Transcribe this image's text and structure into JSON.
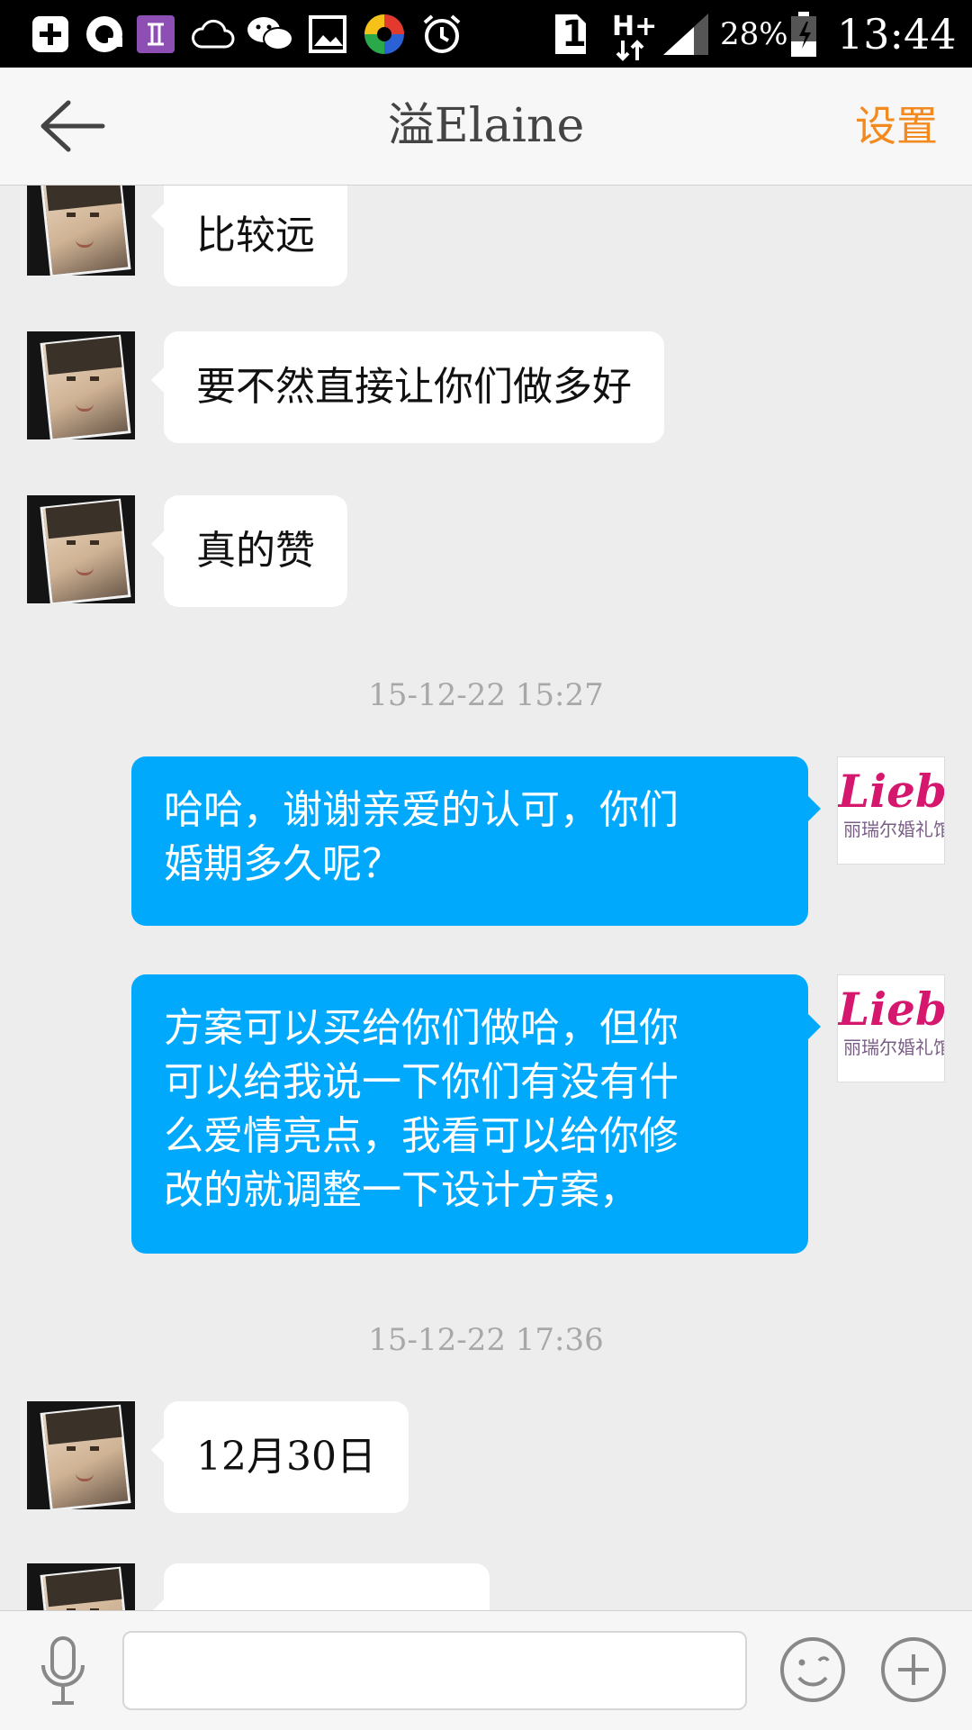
{
  "status_bar": {
    "battery": "28%",
    "time": "13:44",
    "sim": "1",
    "network": "H+",
    "icons": [
      "add-box-icon",
      "qq-icon",
      "gemini-icon",
      "cloud-icon",
      "wechat-icon",
      "gallery-icon",
      "pinwheel-icon",
      "alarm-icon",
      "sim-icon",
      "network-icon",
      "signal-icon",
      "battery-icon"
    ]
  },
  "header": {
    "title": "溢Elaine",
    "settings_label": "设置"
  },
  "messages": [
    {
      "side": "in",
      "text": "比较远"
    },
    {
      "side": "in",
      "text": "要不然直接让你们做多好"
    },
    {
      "side": "in",
      "text": "真的赞"
    },
    {
      "type": "time",
      "text": "15-12-22 15:27"
    },
    {
      "side": "out",
      "lines": [
        "哈哈，谢谢亲爱的认可，你们",
        "婚期多久呢？"
      ]
    },
    {
      "side": "out",
      "lines": [
        "方案可以买给你们做哈，但你",
        "可以给我说一下你们有没有什",
        "么爱情亮点，我看可以给你修",
        "改的就调整一下设计方案，"
      ]
    },
    {
      "type": "time",
      "text": "15-12-22 17:36"
    },
    {
      "side": "in",
      "text": "12月30日"
    },
    {
      "side": "in",
      "text": "…"
    }
  ],
  "self_avatar": {
    "brand": "Liebe",
    "sub": "丽瑞尔婚礼馆"
  },
  "input": {
    "value": "",
    "placeholder": ""
  },
  "colors": {
    "accent": "#f38a1f",
    "out_bubble": "#01a9fd",
    "background": "#ededed"
  }
}
